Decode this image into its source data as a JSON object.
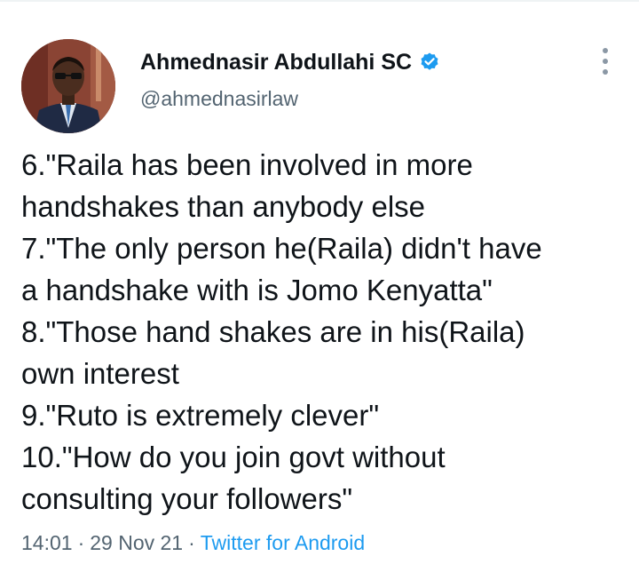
{
  "author": {
    "display_name": "Ahmednasir Abdullahi SC",
    "handle": "@ahmednasirlaw",
    "verified_icon": "verified-badge-icon",
    "avatar_icon": "profile-photo"
  },
  "tweet": {
    "lines": [
      "6.\"Raila has been involved in more",
      "handshakes than anybody else",
      "7.\"The only person he(Raila) didn't have",
      "a handshake with is Jomo Kenyatta\"",
      "8.\"Those hand shakes are in his(Raila)",
      "own interest",
      "9.\"Ruto is extremely clever\"",
      "10.\"How do you join govt without",
      "consulting your followers\""
    ]
  },
  "meta": {
    "time": "14:01",
    "separator": "·",
    "date": "29 Nov 21",
    "source": "Twitter for Android"
  },
  "colors": {
    "text": "#0f1419",
    "secondary": "#536471",
    "link": "#1d9bf0"
  },
  "menu_icon": "more-vertical-icon"
}
